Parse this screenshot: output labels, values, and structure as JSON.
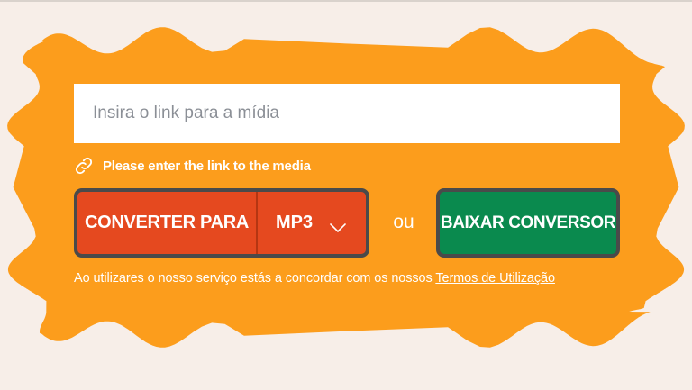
{
  "colors": {
    "background": "#f7eee8",
    "accent_orange": "#fc9d1c",
    "convert_red": "#e5491f",
    "download_green": "#0a8a4e",
    "button_border": "#4a4a4a"
  },
  "form": {
    "url_placeholder": "Insira o link para a mídia",
    "hint_icon": "link-icon",
    "hint_text": "Please enter the link to the media",
    "convert_label": "CONVERTER PARA",
    "format_value": "MP3",
    "format_icon": "chevron-down-icon",
    "or_label": "ou",
    "download_label": "BAIXAR CONVERSOR"
  },
  "terms": {
    "prefix": "Ao utilizares o nosso serviço estás a concordar com os nossos ",
    "link_label": "Termos de Utilização"
  }
}
